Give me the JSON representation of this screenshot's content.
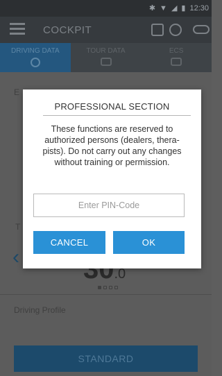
{
  "status_bar": {
    "time": "12:30",
    "icons": [
      "bluetooth-icon",
      "wifi-icon",
      "signal-icon",
      "battery-icon"
    ]
  },
  "app_bar": {
    "title": "COCKPIT",
    "icons": [
      "menu-icon",
      "battery-level-icon",
      "assist-icon",
      "link-icon"
    ]
  },
  "tabs": [
    {
      "label": "DRIVING DATA",
      "icon": "wheelchair-push-icon",
      "active": true
    },
    {
      "label": "TOUR DATA",
      "icon": "gauge-icon",
      "active": false
    },
    {
      "label": "ECS",
      "icon": "calendar-icon",
      "active": false
    }
  ],
  "background": {
    "section_first_label": "E",
    "section_t_label": "T",
    "speed_value": "30",
    "speed_decimal": ".0",
    "driving_profile_label": "Driving Profile",
    "profile_button_label": "STANDARD",
    "pager": {
      "count": 4,
      "active_index": 0
    }
  },
  "dialog": {
    "title": "PROFESSIONAL SECTION",
    "message": "These functions are reserved to authorized persons (dealers, thera-pists). Do not carry out any changes without training or permission.",
    "pin_placeholder": "Enter PIN-Code",
    "cancel_label": "CANCEL",
    "ok_label": "OK"
  },
  "colors": {
    "accent": "#2a91d6",
    "tab_active": "#24577f",
    "overlay_gray": "#5c5c5c"
  }
}
